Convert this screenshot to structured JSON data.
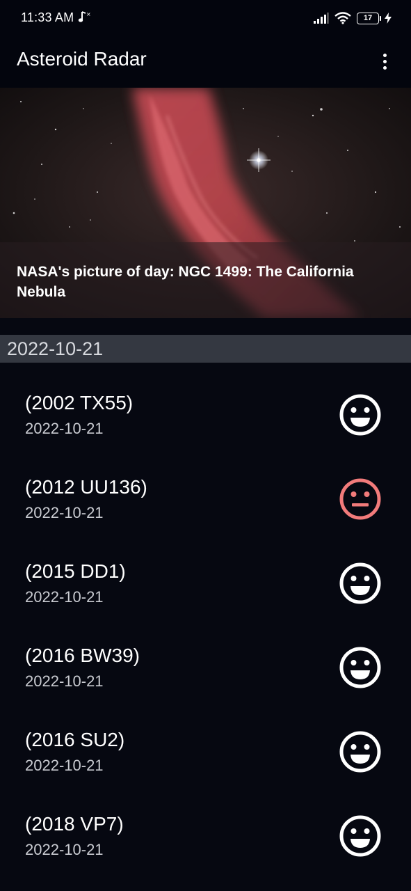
{
  "status_bar": {
    "time": "11:33 AM",
    "battery": "17",
    "icons": [
      "music-note-icon",
      "signal-icon",
      "wifi-icon",
      "battery-icon",
      "charging-icon"
    ]
  },
  "app_bar": {
    "title": "Asteroid Radar",
    "menu_icon": "more-vert-icon"
  },
  "picture_of_day": {
    "caption": "NASA's picture of day: NGC 1499: The California Nebula"
  },
  "section": {
    "date": "2022-10-21"
  },
  "asteroids": [
    {
      "name": "(2002 TX55)",
      "date": "2022-10-21",
      "hazardous": false,
      "icon": "happy-face-icon",
      "color": "#ffffff"
    },
    {
      "name": "(2012 UU136)",
      "date": "2022-10-21",
      "hazardous": true,
      "icon": "neutral-face-icon",
      "color": "#f27b7b"
    },
    {
      "name": "(2015 DD1)",
      "date": "2022-10-21",
      "hazardous": false,
      "icon": "happy-face-icon",
      "color": "#ffffff"
    },
    {
      "name": "(2016 BW39)",
      "date": "2022-10-21",
      "hazardous": false,
      "icon": "happy-face-icon",
      "color": "#ffffff"
    },
    {
      "name": "(2016 SU2)",
      "date": "2022-10-21",
      "hazardous": false,
      "icon": "happy-face-icon",
      "color": "#ffffff"
    },
    {
      "name": "(2018 VP7)",
      "date": "2022-10-21",
      "hazardous": false,
      "icon": "happy-face-icon",
      "color": "#ffffff"
    }
  ]
}
